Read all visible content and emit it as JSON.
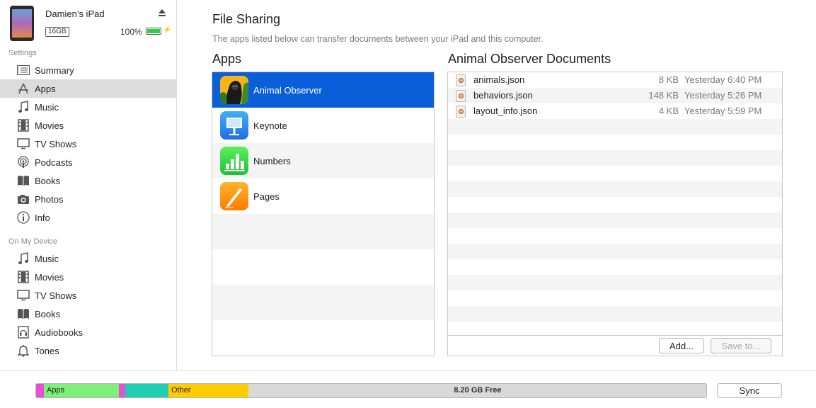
{
  "device": {
    "name": "Damien’s iPad",
    "capacity": "16GB",
    "battery_percent": "100%",
    "battery_level": 1.0
  },
  "sidebar": {
    "settings_title": "Settings",
    "settings_items": [
      {
        "label": "Summary",
        "icon": "summary-icon"
      },
      {
        "label": "Apps",
        "icon": "apps-icon",
        "selected": true
      },
      {
        "label": "Music",
        "icon": "music-icon"
      },
      {
        "label": "Movies",
        "icon": "movies-icon"
      },
      {
        "label": "TV Shows",
        "icon": "tv-shows-icon"
      },
      {
        "label": "Podcasts",
        "icon": "podcasts-icon"
      },
      {
        "label": "Books",
        "icon": "books-icon"
      },
      {
        "label": "Photos",
        "icon": "photos-icon"
      },
      {
        "label": "Info",
        "icon": "info-icon"
      }
    ],
    "device_title": "On My Device",
    "device_items": [
      {
        "label": "Music",
        "icon": "music-icon"
      },
      {
        "label": "Movies",
        "icon": "movies-icon"
      },
      {
        "label": "TV Shows",
        "icon": "tv-shows-icon"
      },
      {
        "label": "Books",
        "icon": "books-icon"
      },
      {
        "label": "Audiobooks",
        "icon": "audiobooks-icon"
      },
      {
        "label": "Tones",
        "icon": "tones-icon"
      }
    ]
  },
  "file_sharing": {
    "title": "File Sharing",
    "description": "The apps listed below can transfer documents between your iPad and this computer.",
    "apps_title": "Apps",
    "docs_title": "Animal Observer Documents",
    "apps": [
      {
        "label": "Animal Observer",
        "icon": "animal-observer-icon",
        "selected": true
      },
      {
        "label": "Keynote",
        "icon": "keynote-icon"
      },
      {
        "label": "Numbers",
        "icon": "numbers-icon"
      },
      {
        "label": "Pages",
        "icon": "pages-icon"
      }
    ],
    "documents": [
      {
        "name": "animals.json",
        "size": "8 KB",
        "date": "Yesterday 6:40 PM"
      },
      {
        "name": "behaviors.json",
        "size": "148 KB",
        "date": "Yesterday 5:26 PM"
      },
      {
        "name": "layout_info.json",
        "size": "4 KB",
        "date": "Yesterday 5:59 PM"
      }
    ],
    "add_label": "Add...",
    "save_label": "Save to..."
  },
  "storage": {
    "segments": [
      {
        "label": "",
        "color": "#e84fd8"
      },
      {
        "label": "Apps",
        "color": "#7ef07a"
      },
      {
        "label": "",
        "color": "#e84fd8"
      },
      {
        "label": "",
        "color": "#1fcfb0"
      },
      {
        "label": "Other",
        "color": "#ffcc00"
      }
    ],
    "free_label": "8.20 GB Free",
    "sync_label": "Sync"
  },
  "colors": {
    "selection_blue": "#0a5fd8",
    "sidebar_selected": "#dcdcdc"
  }
}
